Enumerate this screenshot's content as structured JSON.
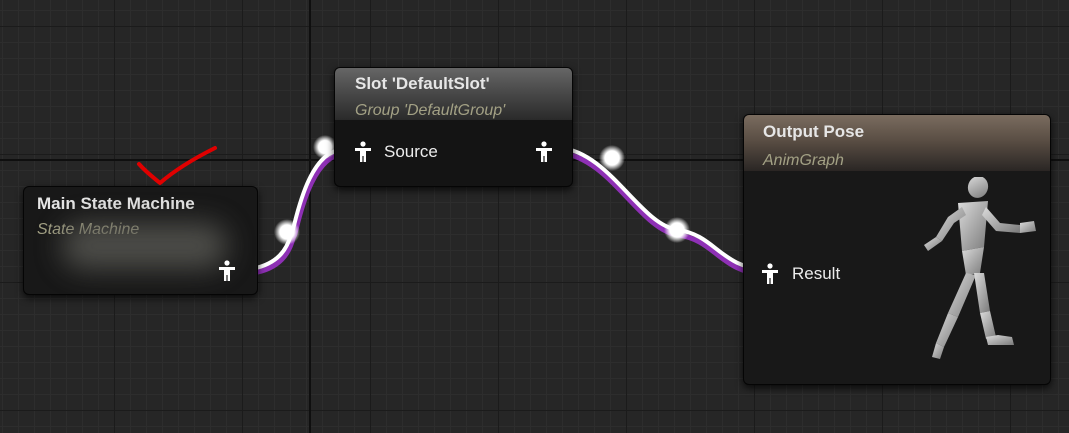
{
  "graph": {
    "nodes": {
      "main_state_machine": {
        "title": "Main State Machine",
        "subtitle": "State Machine",
        "output_pin_icon": "pose-pin-icon"
      },
      "slot": {
        "title": "Slot 'DefaultSlot'",
        "subtitle": "Group 'DefaultGroup'",
        "input_pin": "Source",
        "output_pin_icon": "pose-pin-icon"
      },
      "output_pose": {
        "title": "Output Pose",
        "subtitle": "AnimGraph",
        "input_pin": "Result",
        "preview_icon": "running-mannequin-icon"
      }
    },
    "colors": {
      "wire": "#ffffff",
      "wire_glow": "#8e30b5",
      "annotation": "#e00000"
    }
  }
}
